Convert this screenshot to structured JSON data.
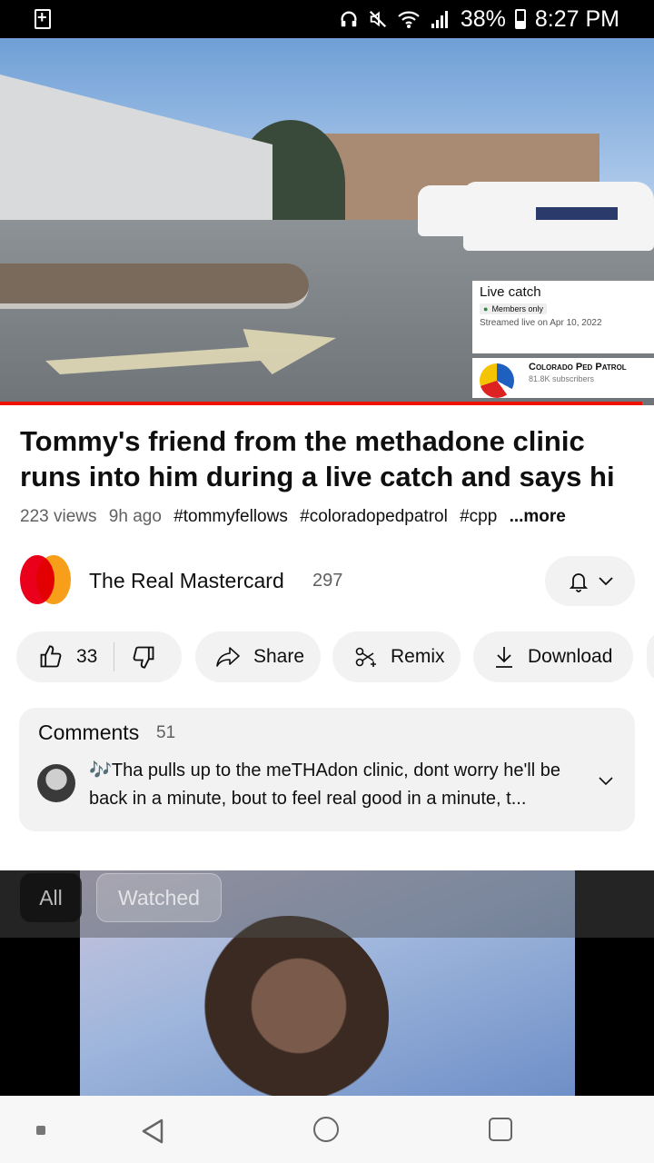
{
  "status_bar": {
    "battery": "38%",
    "time": "8:27 PM"
  },
  "video_overlay": {
    "title": "Live catch",
    "badge": "Members only",
    "streamed": "Streamed live on Apr 10, 2022",
    "channel": "Colorado Ped Patrol",
    "subscribers": "81.8K subscribers"
  },
  "video": {
    "title": "Tommy's friend from the methadone clinic runs into him during a live catch and says hi",
    "views": "223 views",
    "age": "9h ago",
    "tags": [
      "#tommyfellows",
      "#coloradopedpatrol",
      "#cpp"
    ],
    "more": "...more"
  },
  "channel": {
    "name": "The Real Mastercard",
    "subscribers": "297"
  },
  "actions": {
    "likes": "33",
    "share": "Share",
    "remix": "Remix",
    "download": "Download"
  },
  "comments": {
    "label": "Comments",
    "count": "51",
    "top_comment": "🎶Tha pulls up to the meTHAdon clinic, dont worry he'll be back in a minute, bout to feel real good in a minute, t..."
  },
  "chips": [
    "All",
    "Watched"
  ],
  "colors": {
    "accent_red": "#ee1100",
    "pill_bg": "#f2f2f2",
    "text_secondary": "#606060"
  }
}
